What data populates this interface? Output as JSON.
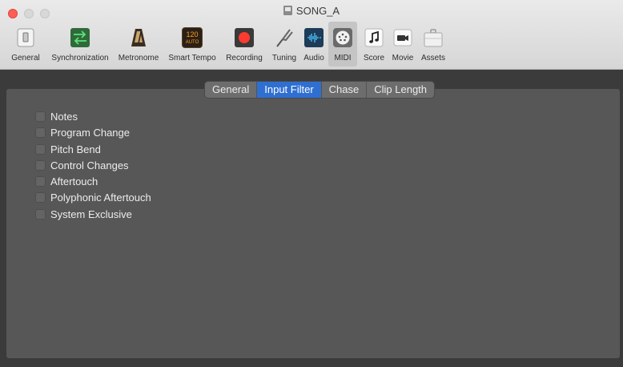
{
  "window": {
    "title": "SONG_A"
  },
  "toolbar": {
    "items": [
      {
        "label": "General",
        "icon": "switch-icon"
      },
      {
        "label": "Synchronization",
        "icon": "sync-arrows-icon"
      },
      {
        "label": "Metronome",
        "icon": "metronome-icon"
      },
      {
        "label": "Smart Tempo",
        "icon": "smart-tempo-icon",
        "badge_top": "120",
        "badge_bottom": "AUTO"
      },
      {
        "label": "Recording",
        "icon": "record-icon"
      },
      {
        "label": "Tuning",
        "icon": "tuning-fork-icon"
      },
      {
        "label": "Audio",
        "icon": "waveform-icon"
      },
      {
        "label": "MIDI",
        "icon": "midi-icon",
        "selected": true
      },
      {
        "label": "Score",
        "icon": "music-note-icon"
      },
      {
        "label": "Movie",
        "icon": "movie-camera-icon"
      },
      {
        "label": "Assets",
        "icon": "briefcase-icon"
      }
    ]
  },
  "tabs": [
    {
      "label": "General"
    },
    {
      "label": "Input Filter",
      "active": true
    },
    {
      "label": "Chase"
    },
    {
      "label": "Clip Length"
    }
  ],
  "filters": [
    {
      "label": "Notes",
      "checked": false
    },
    {
      "label": "Program Change",
      "checked": false
    },
    {
      "label": "Pitch Bend",
      "checked": false
    },
    {
      "label": "Control Changes",
      "checked": false
    },
    {
      "label": "Aftertouch",
      "checked": false
    },
    {
      "label": "Polyphonic Aftertouch",
      "checked": false
    },
    {
      "label": "System Exclusive",
      "checked": false
    }
  ],
  "colors": {
    "accent": "#2f6fd1",
    "record": "#ff3b30",
    "panel": "#575757"
  }
}
